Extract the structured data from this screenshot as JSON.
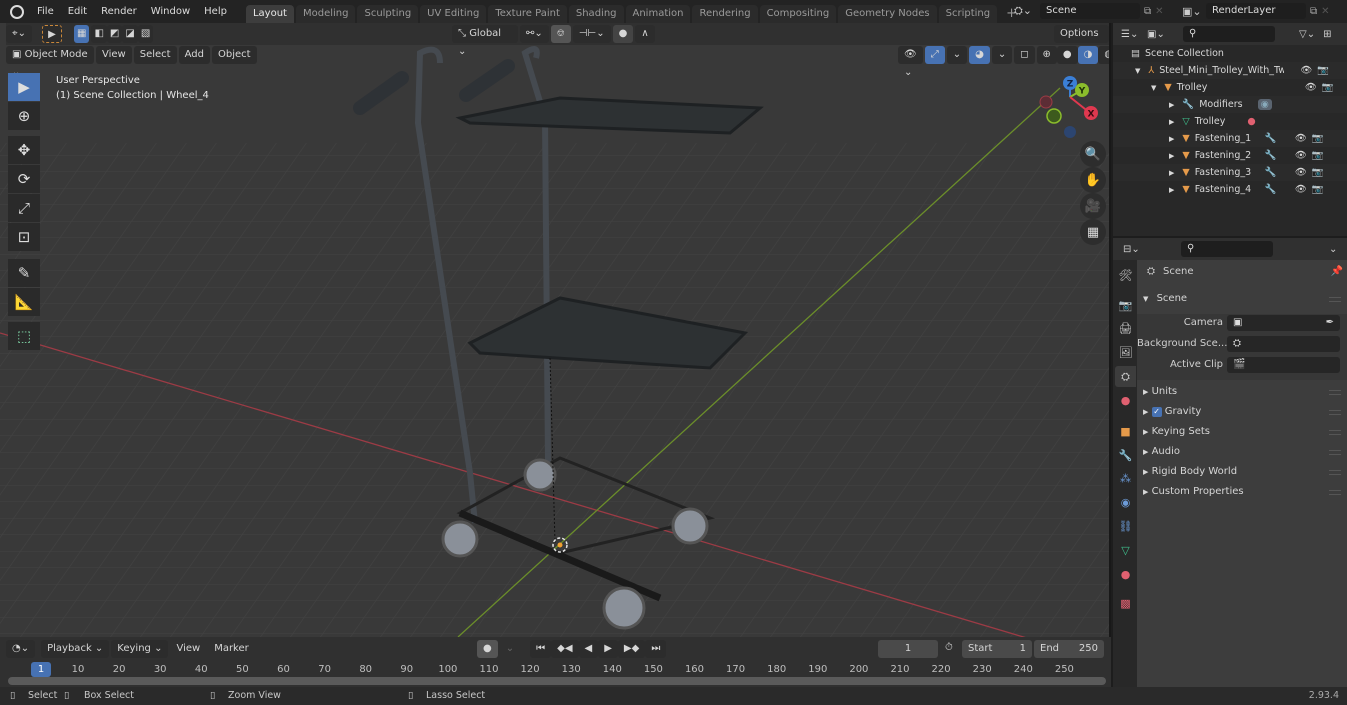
{
  "app": {
    "name": "Blender",
    "version": "2.93.4"
  },
  "topbar": {
    "menus": [
      "File",
      "Edit",
      "Render",
      "Window",
      "Help"
    ],
    "workspace_tabs": [
      "Layout",
      "Modeling",
      "Sculpting",
      "UV Editing",
      "Texture Paint",
      "Shading",
      "Animation",
      "Rendering",
      "Compositing",
      "Geometry Nodes",
      "Scripting"
    ],
    "active_tab": "Layout",
    "add_tab_label": "+",
    "scene_field": "Scene",
    "view_layer_field": "RenderLayer"
  },
  "viewport": {
    "mode": "Object Mode",
    "menus": [
      "View",
      "Select",
      "Add",
      "Object"
    ],
    "transform_orientation": "Global",
    "options_label": "Options",
    "overlay_title": "User Perspective",
    "overlay_subtitle": "(1) Scene Collection | Wheel_4",
    "gizmo_axes": {
      "x": "X",
      "y": "Y",
      "z": "Z"
    },
    "colors": {
      "x_axis": "#9c3b45",
      "y_axis": "#6b8e2a",
      "active_tool": "#4772b3",
      "gizmo_x": "#e0384f",
      "gizmo_y": "#8bbd2c",
      "gizmo_z": "#3b7fd6"
    },
    "tools": [
      "select-box",
      "cursor",
      "move",
      "rotate",
      "scale",
      "transform",
      "annotate",
      "measure",
      "add-cube"
    ],
    "nav_buttons": [
      "zoom",
      "pan",
      "camera",
      "perspective-toggle"
    ]
  },
  "outliner": {
    "root": "Scene Collection",
    "items": [
      {
        "label": "Steel_Mini_Trolley_With_Two_",
        "type": "empty",
        "depth": 1,
        "expanded": true,
        "visible": true,
        "renderable": true
      },
      {
        "label": "Trolley",
        "type": "object",
        "depth": 2,
        "expanded": true,
        "visible": true,
        "renderable": true
      },
      {
        "label": "Modifiers",
        "type": "modifiers",
        "depth": 3,
        "expanded": false
      },
      {
        "label": "Trolley",
        "type": "mesh",
        "depth": 3,
        "expanded": false
      },
      {
        "label": "Fastening_1",
        "type": "object",
        "depth": 3,
        "expanded": false,
        "visible": true,
        "renderable": true
      },
      {
        "label": "Fastening_2",
        "type": "object",
        "depth": 3,
        "expanded": false,
        "visible": true,
        "renderable": true
      },
      {
        "label": "Fastening_3",
        "type": "object",
        "depth": 3,
        "expanded": false,
        "visible": true,
        "renderable": true
      },
      {
        "label": "Fastening_4",
        "type": "object",
        "depth": 3,
        "expanded": false,
        "visible": true,
        "renderable": true
      }
    ]
  },
  "properties": {
    "context_title": "Scene",
    "scene_panel": {
      "title": "Scene",
      "fields": [
        {
          "label": "Camera",
          "value": ""
        },
        {
          "label": "Background Sce...",
          "value": ""
        },
        {
          "label": "Active Clip",
          "value": ""
        }
      ]
    },
    "collapsed_panels": [
      "Units",
      "Gravity",
      "Keying Sets",
      "Audio",
      "Rigid Body World",
      "Custom Properties"
    ],
    "gravity_checked": true,
    "tabs": [
      "tool",
      "render",
      "output",
      "view-layer",
      "scene",
      "world",
      "object",
      "modifiers",
      "particles",
      "physics",
      "constraints",
      "data",
      "material",
      "texture"
    ],
    "active_tab": "scene"
  },
  "timeline": {
    "menus": [
      "Playback",
      "Keying",
      "View",
      "Marker"
    ],
    "current_frame": "1",
    "start_label": "Start",
    "start_value": "1",
    "end_label": "End",
    "end_value": "250",
    "ruler": [
      "1",
      "10",
      "20",
      "30",
      "40",
      "50",
      "60",
      "70",
      "80",
      "90",
      "100",
      "110",
      "120",
      "130",
      "140",
      "150",
      "160",
      "170",
      "180",
      "190",
      "200",
      "210",
      "220",
      "230",
      "240",
      "250"
    ]
  },
  "statusbar": {
    "hints": [
      {
        "icon": "mouse-left-icon",
        "label": "Select"
      },
      {
        "icon": "mouse-left-drag-icon",
        "label": "Box Select"
      },
      {
        "icon": "mouse-middle-icon",
        "label": "Zoom View"
      },
      {
        "icon": "mouse-right-drag-icon",
        "label": "Lasso Select"
      }
    ],
    "version": "2.93.4"
  }
}
